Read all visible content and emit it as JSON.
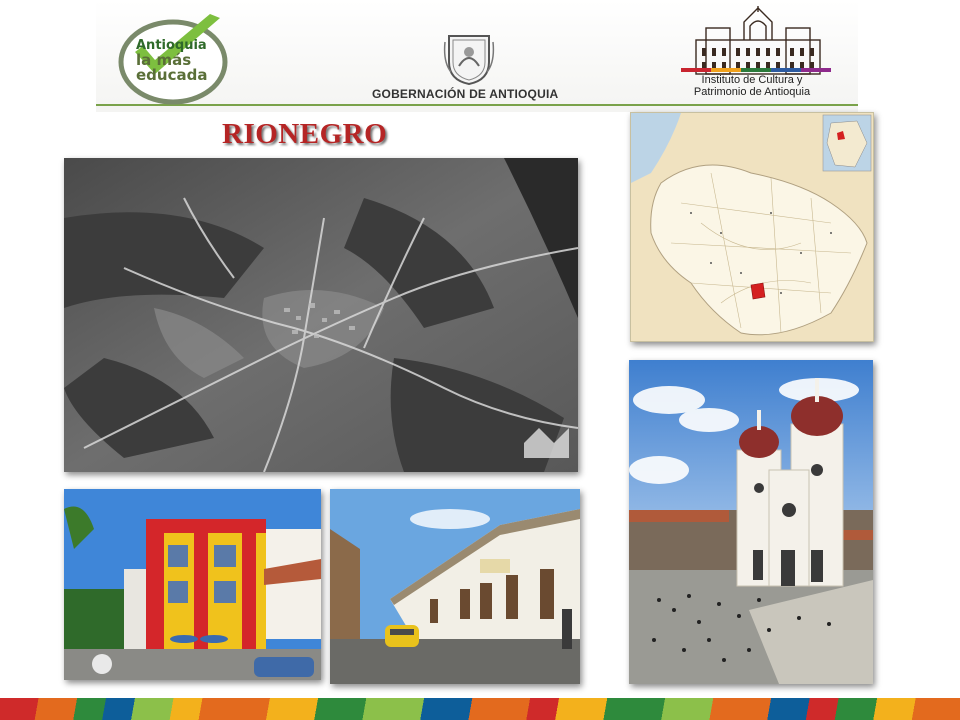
{
  "header": {
    "edu_logo_lines": [
      "Antioquia",
      "la más",
      "educada"
    ],
    "gobernacion_label": "GOBERNACIÓN DE ANTIOQUIA",
    "instituto_lines": [
      "Instituto de Cultura y",
      "Patrimonio de Antioquia"
    ]
  },
  "title": "RIONEGRO",
  "images": {
    "aerial": "aerial-photo-rionegro",
    "map": "antioquia-locator-map",
    "cathedral": "cathedral-plaza-photo",
    "building": "yellow-red-building-photo",
    "street": "street-colonial-photo"
  },
  "colors": {
    "title": "#b52525",
    "map_land": "#f6ecd2",
    "map_highlight": "#d42020",
    "accent_green": "#7aa24a"
  }
}
